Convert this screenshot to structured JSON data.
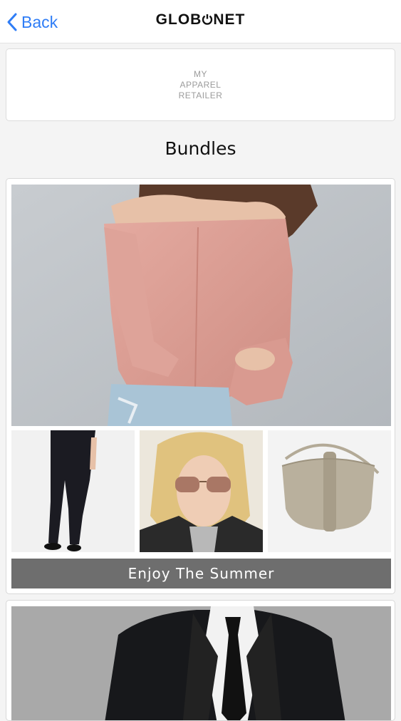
{
  "nav": {
    "back_label": "Back",
    "brand_left": "GLOB",
    "brand_right": "NET"
  },
  "retailer": {
    "logo_lines": [
      "MY",
      "APPAREL",
      "RETAILER"
    ]
  },
  "section": {
    "title": "Bundles"
  },
  "bundles": [
    {
      "caption": "Enjoy The Summer",
      "hero": "woman-pink-off-shoulder-blouse-photo",
      "items": [
        "black-jeans-photo",
        "sunglasses-model-photo",
        "beige-saddle-bag-photo"
      ]
    },
    {
      "hero": "man-black-suit-tie-photo"
    }
  ],
  "colors": {
    "accent": "#2f7df6",
    "caption_bg": "#6e6e6e",
    "page_bg": "#f4f4f4"
  }
}
